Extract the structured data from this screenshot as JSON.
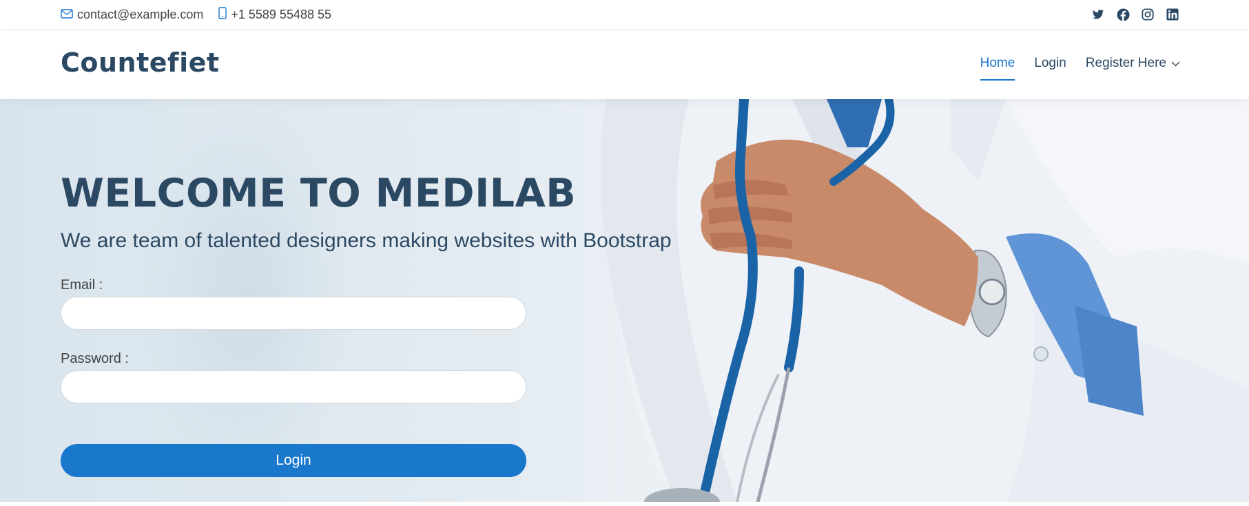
{
  "topbar": {
    "email": "contact@example.com",
    "phone": "+1 5589 55488 55",
    "socials": [
      "twitter-icon",
      "facebook-icon",
      "instagram-icon",
      "linkedin-icon"
    ]
  },
  "header": {
    "logo": "Countefiet",
    "nav": {
      "home": "Home",
      "login": "Login",
      "register": "Register Here"
    }
  },
  "hero": {
    "title": "WELCOME TO MEDILAB",
    "subtitle": "We are team of talented designers making websites with Bootstrap",
    "email_label": "Email :",
    "email_value": "",
    "password_label": "Password :",
    "password_value": "",
    "login_button": "Login"
  },
  "colors": {
    "primary": "#1977cc",
    "heading": "#2c4964",
    "text": "#444444"
  }
}
